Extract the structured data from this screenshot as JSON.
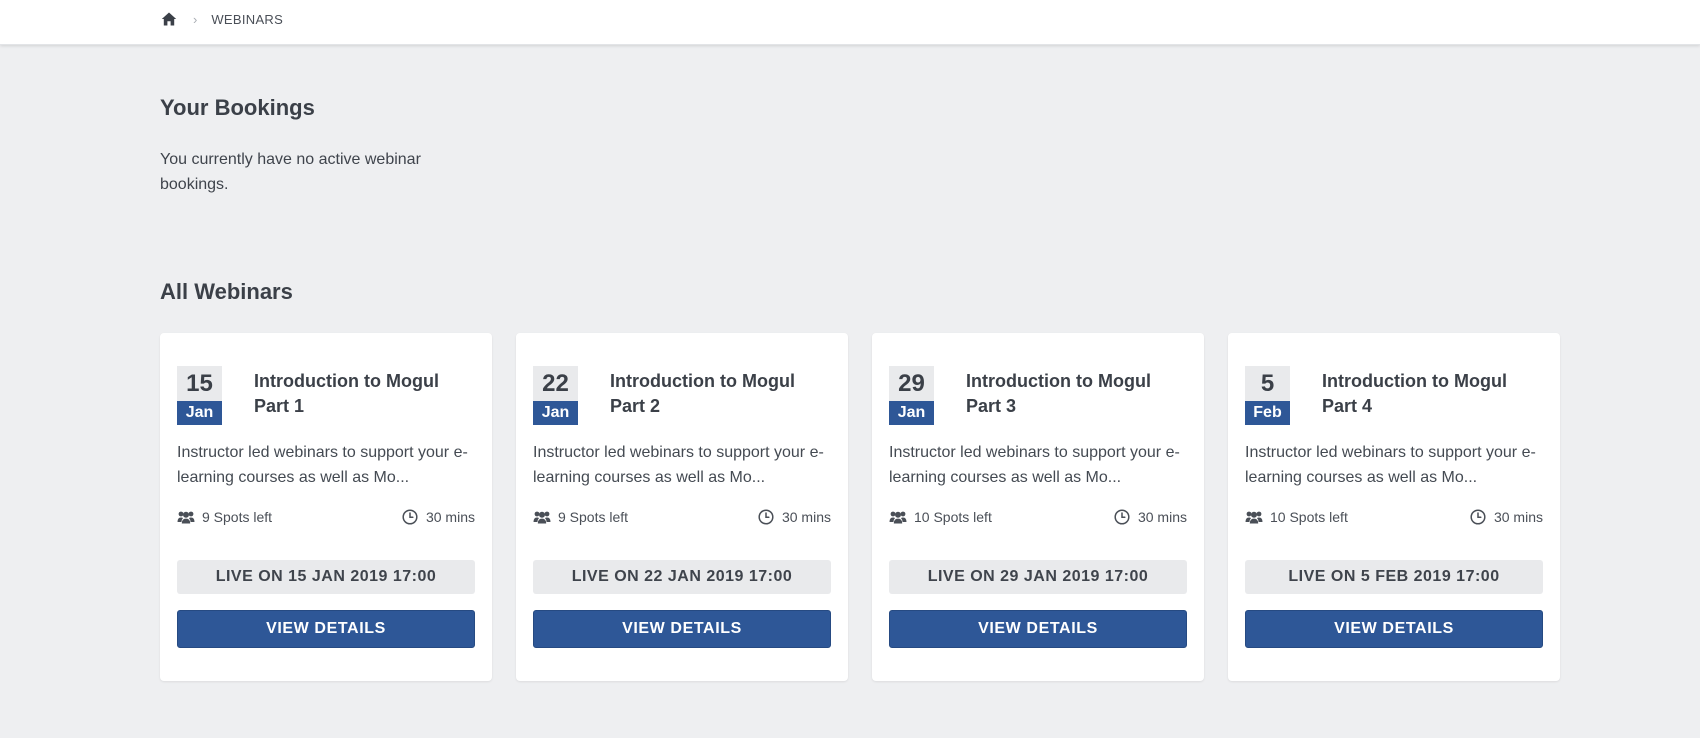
{
  "breadcrumb": {
    "home_icon": "home-icon",
    "separator": "›",
    "current": "WEBINARS"
  },
  "bookings": {
    "title": "Your Bookings",
    "empty_message": "You currently have no active webinar bookings."
  },
  "webinars": {
    "title": "All Webinars",
    "cards": [
      {
        "day": "15",
        "month": "Jan",
        "title": "Introduction to Mogul Part 1",
        "description": "Instructor led webinars to support your e-learning courses as well as Mo...",
        "spots": "9 Spots left",
        "duration": "30 mins",
        "live": "LIVE ON 15 JAN 2019 17:00",
        "button": "VIEW DETAILS"
      },
      {
        "day": "22",
        "month": "Jan",
        "title": "Introduction to Mogul Part 2",
        "description": "Instructor led webinars to support your e-learning courses as well as Mo...",
        "spots": "9 Spots left",
        "duration": "30 mins",
        "live": "LIVE ON 22 JAN 2019 17:00",
        "button": "VIEW DETAILS"
      },
      {
        "day": "29",
        "month": "Jan",
        "title": "Introduction to Mogul Part 3",
        "description": "Instructor led webinars to support your e-learning courses as well as Mo...",
        "spots": "10 Spots left",
        "duration": "30 mins",
        "live": "LIVE ON 29 JAN 2019 17:00",
        "button": "VIEW DETAILS"
      },
      {
        "day": "5",
        "month": "Feb",
        "title": "Introduction to Mogul Part 4",
        "description": "Instructor led webinars to support your e-learning courses as well as Mo...",
        "spots": "10 Spots left",
        "duration": "30 mins",
        "live": "LIVE ON 5 FEB 2019 17:00",
        "button": "VIEW DETAILS"
      }
    ]
  },
  "colors": {
    "page_bg": "#eeeff1",
    "accent": "#2e5797",
    "badge_bg": "#e9eaec"
  }
}
